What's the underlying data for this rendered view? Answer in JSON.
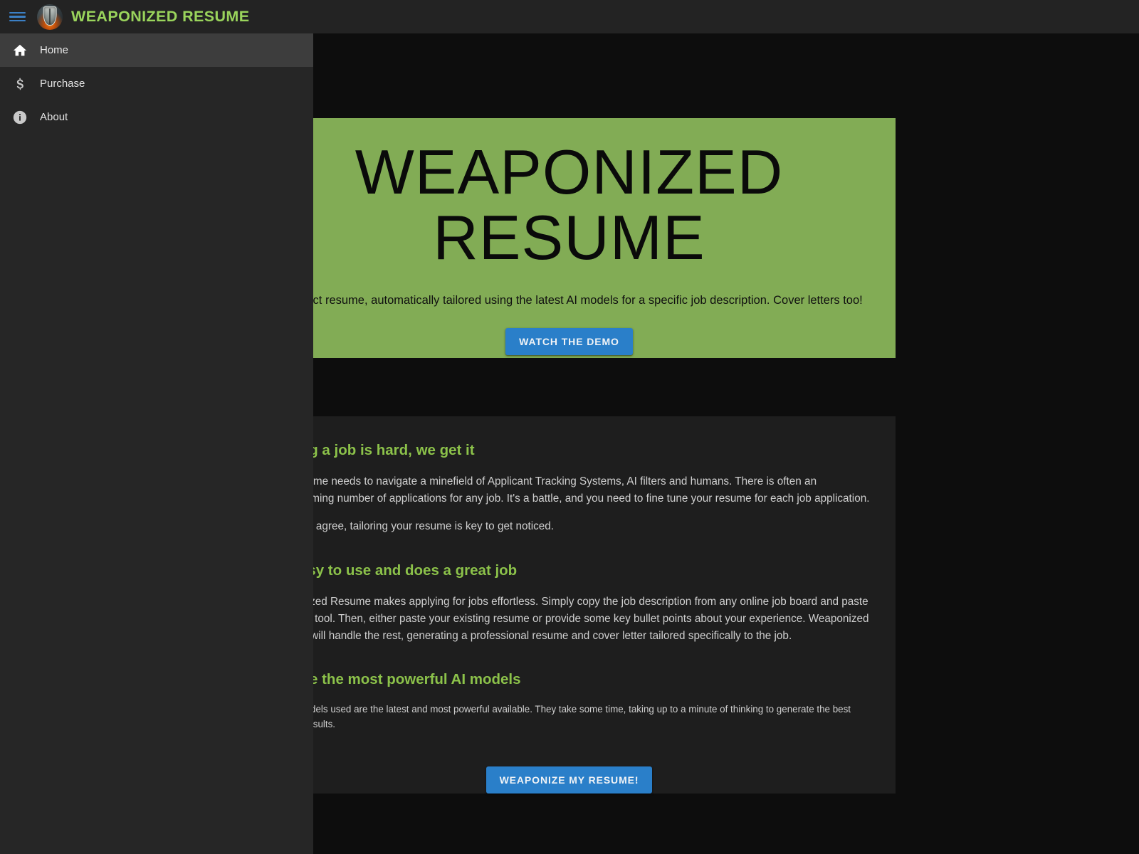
{
  "appbar": {
    "menu_icon": "hamburger-menu-icon",
    "logo_icon": "shield-logo-icon",
    "title": "WEAPONIZED RESUME",
    "title_color": "#9ad45c",
    "background_color": "#232323"
  },
  "sidebar": {
    "background_color": "#262626",
    "active_background_color": "#3d3d3d",
    "items": [
      {
        "label": "Home",
        "icon": "home-icon",
        "active": true
      },
      {
        "label": "Purchase",
        "icon": "dollar-sign-icon",
        "active": false
      },
      {
        "label": "About",
        "icon": "info-circle-icon",
        "active": false
      }
    ]
  },
  "hero": {
    "background_color": "#82ac55",
    "title_line1": "WEAPONIZED",
    "title_line2": "RESUME",
    "tagline": "A perfect resume, automatically tailored using the latest AI models for a specific job description. Cover letters too!",
    "cta_label": "WATCH THE DEMO",
    "cta_color": "#2a7fc9"
  },
  "main": {
    "card_background_color": "#1e1e1e",
    "heading_color": "#8cc24a",
    "sections": [
      {
        "heading": "Getting a job is hard, we get it",
        "paragraphs": [
          "Your resume needs to navigate a minefield of Applicant Tracking Systems, AI filters and humans. There is often an overwhelming number of applications for any job. It's a battle, and you need to fine tune your resume for each job application.",
          "Everyone agree, tailoring your resume is key to get noticed."
        ]
      },
      {
        "heading": "It's easy to use and does a great job",
        "paragraphs": [
          "Weaponized Resume makes applying for jobs effortless. Simply copy the job description from any online job board and paste it into our tool. Then, either paste your existing resume or provide some key bullet points about your experience. Weaponized Resume will handle the rest, generating a professional resume and cover letter tailored specifically to the job."
        ]
      },
      {
        "heading": "We use the most powerful AI models",
        "paragraphs": [
          "The AI models used are the latest and most powerful available. They take some time, taking up to a minute of thinking to generate the best possible results."
        ]
      }
    ],
    "cta_label": "WEAPONIZE MY RESUME!",
    "cta_color": "#2a7fc9"
  }
}
